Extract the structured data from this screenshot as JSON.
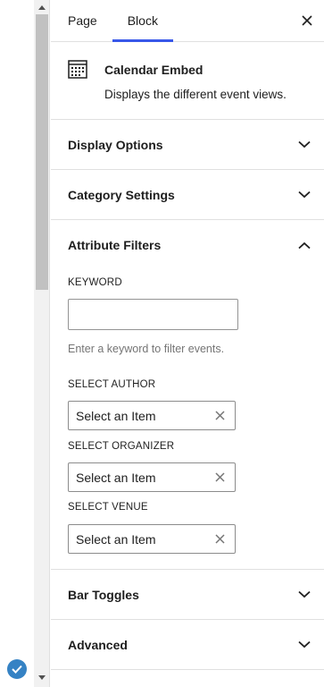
{
  "tabs": [
    {
      "label": "Page",
      "active": false
    },
    {
      "label": "Block",
      "active": true
    }
  ],
  "block": {
    "title": "Calendar Embed",
    "description": "Displays the different event views."
  },
  "sections": {
    "display_options": "Display Options",
    "category_settings": "Category Settings",
    "attribute_filters": "Attribute Filters",
    "bar_toggles": "Bar Toggles",
    "advanced": "Advanced"
  },
  "filters": {
    "keyword_label": "KEYWORD",
    "keyword_value": "",
    "keyword_help": "Enter a keyword to filter events.",
    "author_label": "SELECT AUTHOR",
    "author_value": "Select an Item",
    "organizer_label": "SELECT ORGANIZER",
    "organizer_value": "Select an Item",
    "venue_label": "SELECT VENUE",
    "venue_value": "Select an Item"
  },
  "colors": {
    "accent": "#3858e9",
    "badge": "#3582c4",
    "border": "#e0e0e0",
    "help_text": "#757575"
  },
  "icons": [
    "calendar-icon",
    "close-icon",
    "chevron-down-icon",
    "chevron-up-icon",
    "clear-icon",
    "check-icon"
  ]
}
